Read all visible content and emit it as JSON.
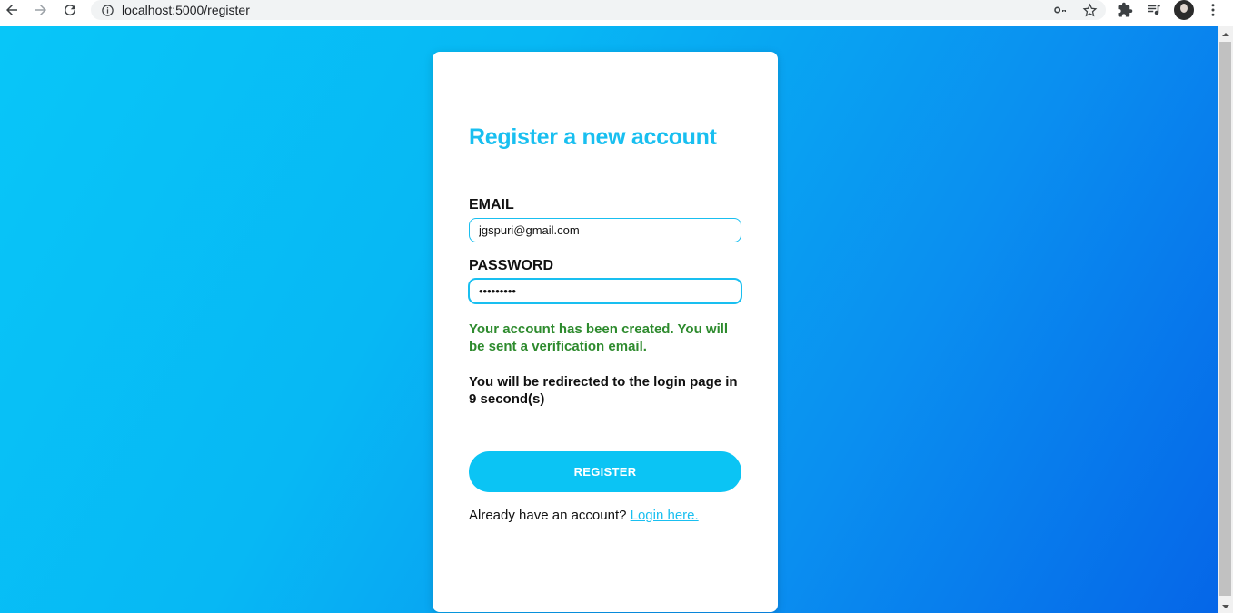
{
  "browser": {
    "url": "localhost:5000/register",
    "icons": [
      "back-arrow-icon",
      "forward-arrow-icon",
      "reload-icon",
      "info-icon",
      "key-icon",
      "star-icon",
      "extensions-icon",
      "media-queue-icon",
      "profile-avatar",
      "more-menu-icon"
    ]
  },
  "form": {
    "title": "Register a new account",
    "email_label": "EMAIL",
    "email_value": "jgspuri@gmail.com",
    "password_label": "PASSWORD",
    "password_value": "•••••••••",
    "success_message": "Your account has been created. You will be sent a verification email.",
    "redirect_message": "You will be redirected to the login page in 9 second(s)",
    "register_button": "REGISTER",
    "login_prompt": "Already have an account?",
    "login_link": "Login here."
  },
  "colors": {
    "accent": "#19bff0",
    "button": "#0bc4f4",
    "success": "#2e8b2e",
    "background_start": "#08c6f8",
    "background_end": "#0566e8"
  }
}
